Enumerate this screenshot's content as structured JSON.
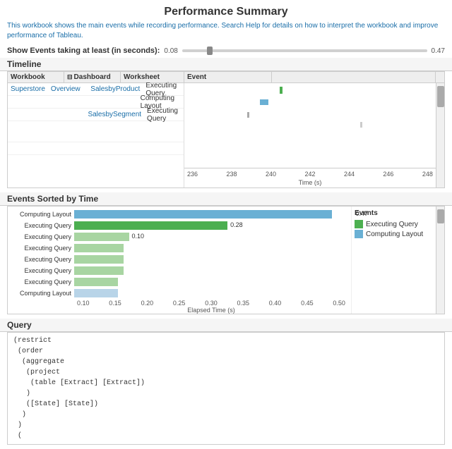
{
  "title": "Performance Summary",
  "description": {
    "text1": "This workbook",
    "text2": " shows the main events while recording performance. Search Help for details on how to interpret the workbook and improve performance of ",
    "text3": "Tableau",
    "link": "Tableau"
  },
  "show_events": {
    "label": "Show Events taking at least (in seconds):",
    "value": "0.08",
    "max_value": "0.47"
  },
  "sections": {
    "timeline": "Timeline",
    "events": "Events Sorted by Time",
    "query": "Query"
  },
  "timeline_headers": {
    "workbook": "Workbook",
    "dashboard": "Dashboard",
    "worksheet": "Worksheet",
    "event": "Event"
  },
  "timeline_rows": [
    {
      "workbook": "Superstore",
      "dashboard": "Overview",
      "worksheet": "SalesbyProduct",
      "event": "Executing Query"
    },
    {
      "workbook": "",
      "dashboard": "",
      "worksheet": "",
      "event": "Computing Layout"
    },
    {
      "workbook": "",
      "dashboard": "",
      "worksheet": "SalesbySegment",
      "event": "Executing Query"
    }
  ],
  "timeline_axis": [
    "236",
    "238",
    "240",
    "242",
    "244",
    "246",
    "248"
  ],
  "timeline_axis_label": "Time (s)",
  "events_list": [
    {
      "label": "Computing Layout",
      "value": 0.47,
      "display": "0.47",
      "color": "#6ab0d4"
    },
    {
      "label": "Executing Query",
      "value": 0.28,
      "display": "0.28",
      "color": "#4caf50"
    },
    {
      "label": "Executing Query",
      "value": 0.1,
      "display": "0.10",
      "color": "#a8d5a2"
    },
    {
      "label": "Executing Query",
      "value": 0.09,
      "display": "0.09",
      "color": "#a8d5a2"
    },
    {
      "label": "Executing Query",
      "value": 0.09,
      "display": "0.09",
      "color": "#a8d5a2"
    },
    {
      "label": "Executing Query",
      "value": 0.09,
      "display": "0.09",
      "color": "#a8d5a2"
    },
    {
      "label": "Executing Query",
      "value": 0.08,
      "display": "0.08",
      "color": "#a8d5a2"
    },
    {
      "label": "Computing Layout",
      "value": 0.08,
      "display": "0.08",
      "color": "#b8d4e8"
    }
  ],
  "events_axis": [
    "0.10",
    "0.15",
    "0.20",
    "0.25",
    "0.30",
    "0.35",
    "0.40",
    "0.45",
    "0.50"
  ],
  "events_axis_label": "Elapsed Time (s)",
  "events_max": 0.5,
  "legend": {
    "title": "Events",
    "items": [
      {
        "label": "Executing Query",
        "color": "#4caf50"
      },
      {
        "label": "Computing Layout",
        "color": "#6ab0d4"
      }
    ]
  },
  "query_text": "(restrict\n (order\n  (aggregate\n   (project\n    (table [Extract] [Extract])\n   )\n   ([State] [State])\n  )\n )\n ("
}
